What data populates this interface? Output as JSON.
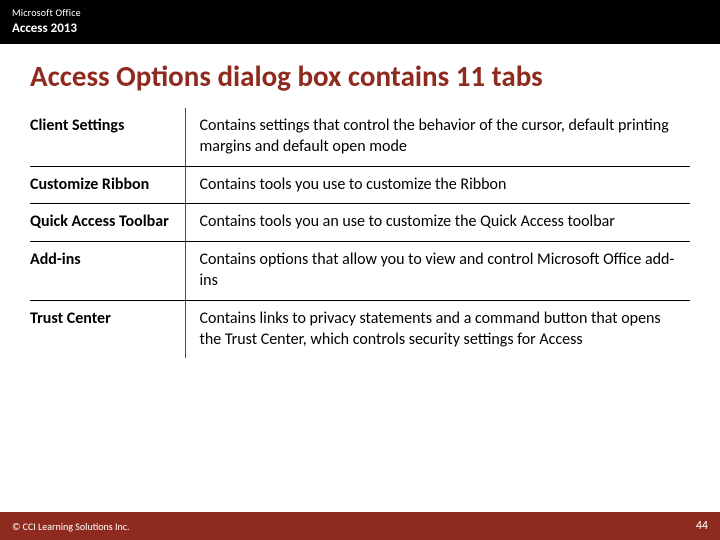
{
  "header": {
    "brand": "Microsoft Office",
    "product": "Access 2013"
  },
  "title": "Access Options dialog box contains 11 tabs",
  "rows": [
    {
      "name": "Client Settings",
      "desc": "Contains settings that control the behavior of the cursor, default printing margins and default open mode"
    },
    {
      "name": "Customize Ribbon",
      "desc": "Contains tools you use to customize the Ribbon"
    },
    {
      "name": "Quick Access Toolbar",
      "desc": "Contains tools you an use to customize the Quick Access toolbar"
    },
    {
      "name": "Add-ins",
      "desc": "Contains options that allow you to view and control Microsoft Office add-ins"
    },
    {
      "name": "Trust Center",
      "desc": "Contains links to privacy statements and a command button that opens the Trust Center, which controls security settings for Access"
    }
  ],
  "footer": {
    "copyright": "© CCI Learning Solutions Inc.",
    "page": "44"
  },
  "colors": {
    "accent": "#8f2a1e",
    "header_bg": "#000000"
  }
}
